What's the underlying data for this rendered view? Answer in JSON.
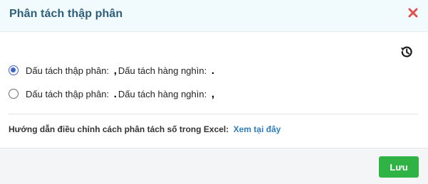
{
  "dialog": {
    "title": "Phân tách thập phân",
    "close_icon": "close-icon",
    "reset_icon": "history-reset-icon"
  },
  "options": [
    {
      "selected": true,
      "decimal_label": "Dấu tách thập phân:",
      "decimal_sep": ",",
      "thousand_label": "Dấu tách hàng nghìn:",
      "thousand_sep": "."
    },
    {
      "selected": false,
      "decimal_label": "Dấu tách thập phân:",
      "decimal_sep": ".",
      "thousand_label": "Dấu tách hàng nghìn:",
      "thousand_sep": ","
    }
  ],
  "guide": {
    "text": "Hướng dẫn điều chỉnh cách phân tách số trong Excel:",
    "link": "Xem tại đây"
  },
  "footer": {
    "save_label": "Lưu"
  },
  "colors": {
    "title": "#2e5f7a",
    "close": "#e0524f",
    "radio_selected": "#3d63c4",
    "link": "#2f7fc0",
    "save_button": "#2fb344"
  }
}
